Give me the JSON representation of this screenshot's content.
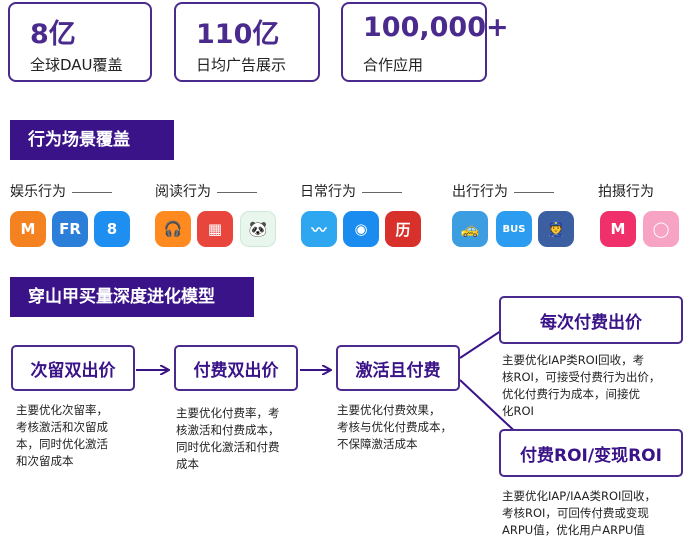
{
  "stats": [
    {
      "value": "8亿",
      "label": "全球DAU覆盖"
    },
    {
      "value": "110亿",
      "label": "日均广告展示"
    },
    {
      "value": "100,000+",
      "label": "合作应用"
    }
  ],
  "section_behavior": "行为场景覆盖",
  "categories": [
    "娱乐行为",
    "阅读行为",
    "日常行为",
    "出行行为",
    "拍摄行为"
  ],
  "app_icons": [
    {
      "name": "video-app-icon",
      "glyph": "M",
      "color": "#f58220"
    },
    {
      "name": "fr-app-icon",
      "glyph": "FR",
      "color": "#2b7fd9"
    },
    {
      "name": "eight-app-icon",
      "glyph": "8",
      "color": "#1f8ef1"
    },
    {
      "name": "headphone-app-icon",
      "glyph": "🎧",
      "color": "#ff8a1f"
    },
    {
      "name": "book-app-icon",
      "glyph": "▦",
      "color": "#e8453c"
    },
    {
      "name": "panda-app-icon",
      "glyph": "🐼",
      "color": "#e9f6ee"
    },
    {
      "name": "weather-app-icon",
      "glyph": "〰",
      "color": "#2ea7f0"
    },
    {
      "name": "wifi-app-icon",
      "glyph": "◉",
      "color": "#1a8cf0"
    },
    {
      "name": "calendar-app-icon",
      "glyph": "历",
      "color": "#d8302a"
    },
    {
      "name": "car-game-app-icon",
      "glyph": "🚕",
      "color": "#3c9de0"
    },
    {
      "name": "bus-app-icon",
      "glyph": "BUS",
      "color": "#2b9cf0"
    },
    {
      "name": "police-game-app-icon",
      "glyph": "👮",
      "color": "#3b5fa0"
    },
    {
      "name": "meitu-app-icon",
      "glyph": "M",
      "color": "#f0306a"
    },
    {
      "name": "camera-app-icon",
      "glyph": "◯",
      "color": "#f7a3c4"
    }
  ],
  "section_model": "穿山甲买量深度进化模型",
  "steps": [
    {
      "title": "次留双出价",
      "desc": [
        "主要优化次留率，",
        "考核激活和次留成",
        "本，同时优化激活",
        "和次留成本"
      ]
    },
    {
      "title": "付费双出价",
      "desc": [
        "主要优化付费率，考",
        "核激活和付费成本，",
        "同时优化激活和付费",
        "成本"
      ]
    },
    {
      "title": "激活且付费",
      "desc": [
        "主要优化付费效果，",
        "考核与优化付费成本，",
        "不保障激活成本"
      ]
    },
    {
      "title": "每次付费出价",
      "desc": [
        "主要优化IAP类ROI回收，考",
        "核ROI，可接受付费行为出价，",
        "优化付费行为成本，间接优",
        "化ROI"
      ]
    },
    {
      "title": "付费ROI/变现ROI",
      "desc": [
        "主要优化IAP/IAA类ROI回收，",
        "考核ROI，可回传付费或变现",
        "ARPU值，优化用户ARPU值"
      ]
    }
  ]
}
